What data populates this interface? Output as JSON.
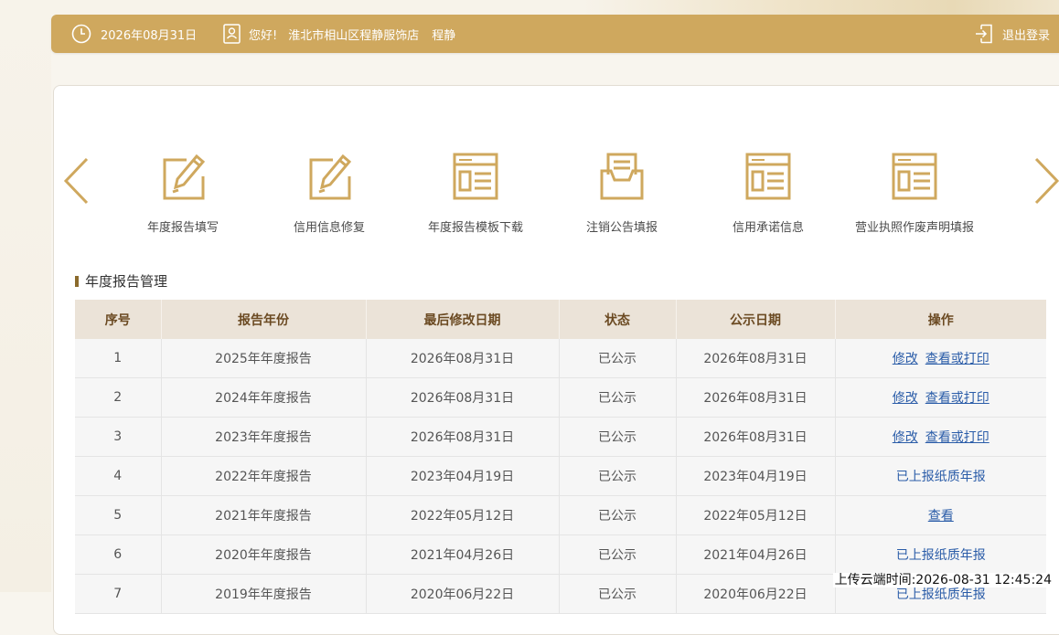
{
  "header": {
    "date": "2026年08月31日",
    "greeting": "您好!",
    "company": "淮北市相山区程静服饰店",
    "user": "程静",
    "logout": "退出登录"
  },
  "functions": [
    {
      "label": "年度报告填写",
      "icon": "edit-icon"
    },
    {
      "label": "信用信息修复",
      "icon": "edit-icon"
    },
    {
      "label": "年度报告模板下载",
      "icon": "document-icon"
    },
    {
      "label": "注销公告填报",
      "icon": "inbox-icon"
    },
    {
      "label": "信用承诺信息",
      "icon": "document-icon"
    },
    {
      "label": "营业执照作废声明填报",
      "icon": "document-icon"
    }
  ],
  "section": {
    "title": "年度报告管理"
  },
  "table": {
    "headers": [
      "序号",
      "报告年份",
      "最后修改日期",
      "状态",
      "公示日期",
      "操作"
    ],
    "rows": [
      {
        "no": "1",
        "year": "2025年年度报告",
        "modified": "2026年08月31日",
        "status": "已公示",
        "published": "2026年08月31日",
        "actions": [
          "修改",
          "查看或打印"
        ]
      },
      {
        "no": "2",
        "year": "2024年年度报告",
        "modified": "2026年08月31日",
        "status": "已公示",
        "published": "2026年08月31日",
        "actions": [
          "修改",
          "查看或打印"
        ]
      },
      {
        "no": "3",
        "year": "2023年年度报告",
        "modified": "2026年08月31日",
        "status": "已公示",
        "published": "2026年08月31日",
        "actions": [
          "修改",
          "查看或打印"
        ]
      },
      {
        "no": "4",
        "year": "2022年年度报告",
        "modified": "2023年04月19日",
        "status": "已公示",
        "published": "2023年04月19日",
        "note": "已上报纸质年报"
      },
      {
        "no": "5",
        "year": "2021年年度报告",
        "modified": "2022年05月12日",
        "status": "已公示",
        "published": "2022年05月12日",
        "actions": [
          "查看"
        ]
      },
      {
        "no": "6",
        "year": "2020年年度报告",
        "modified": "2021年04月26日",
        "status": "已公示",
        "published": "2021年04月26日",
        "note": "已上报纸质年报"
      },
      {
        "no": "7",
        "year": "2019年年度报告",
        "modified": "2020年06月22日",
        "status": "已公示",
        "published": "2020年06月22日",
        "note": "已上报纸质年报"
      }
    ]
  },
  "upload_stamp": "上传云端时间:2026-08-31 12:45:24",
  "colors": {
    "accent": "#cfa85e",
    "link": "#2a5ca8",
    "header_bg": "#ebe3d8"
  }
}
